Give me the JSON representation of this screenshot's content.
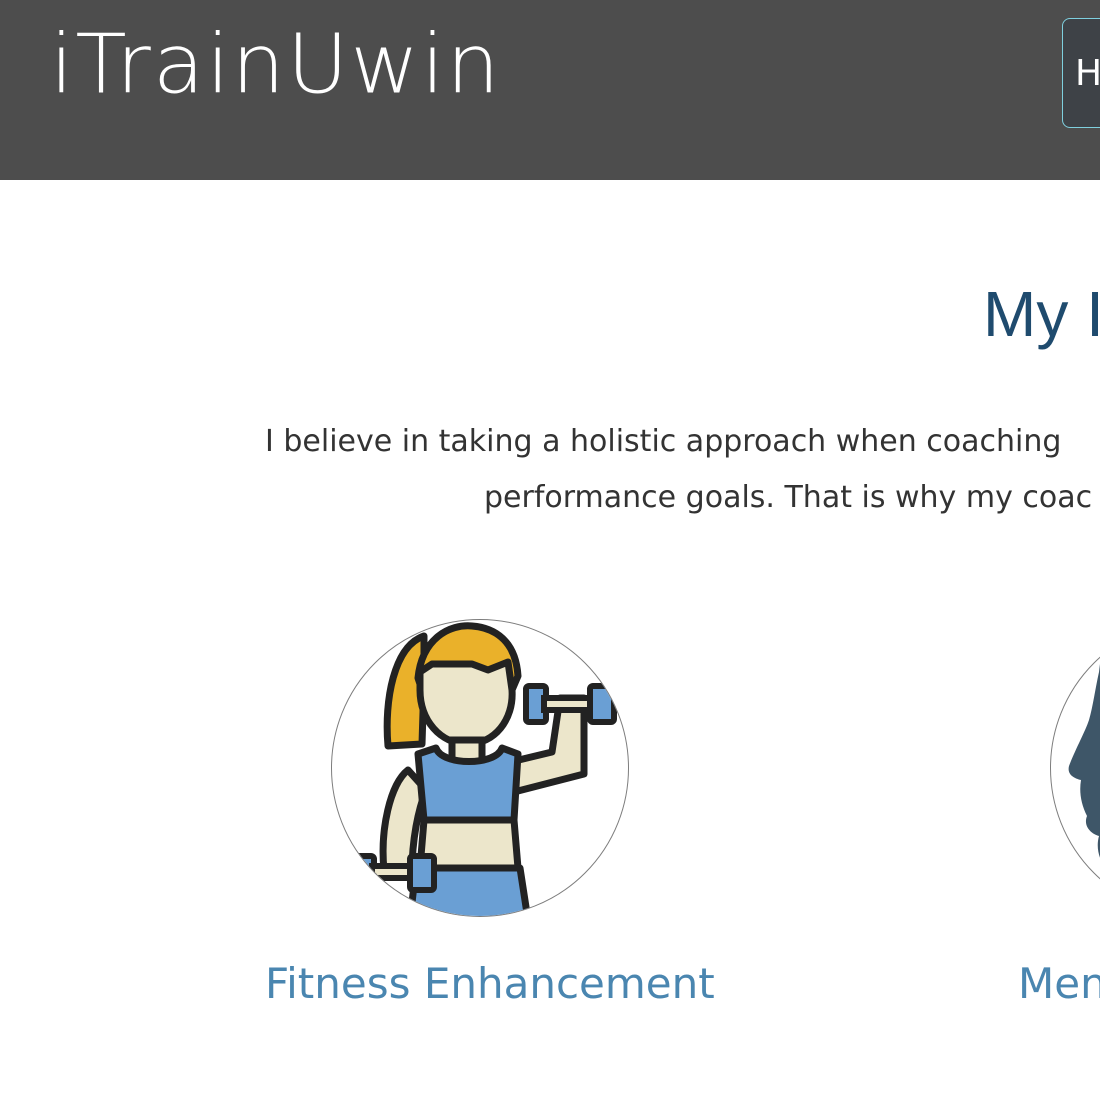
{
  "header": {
    "logo_text": "iTrainUwin",
    "nav_button_label": "H"
  },
  "main": {
    "section_title": "My I",
    "intro_lines": [
      "I believe in taking a holistic approach when coaching",
      "performance goals. That is why my coac"
    ],
    "features": [
      {
        "label": "Fitness Enhancement",
        "icon": "woman-lifting-dumbbell-icon"
      },
      {
        "label": "Men",
        "icon": "head-profile-icon"
      }
    ]
  },
  "colors": {
    "header_bg": "#4d4d4d",
    "title_color": "#1f4b6e",
    "feature_label_color": "#4a86b0",
    "icon_hair": "#eab12a",
    "icon_skin": "#ece6cb",
    "icon_clothes": "#6a9fd4",
    "icon_outline": "#222222",
    "head_silhouette": "#3e5668"
  }
}
